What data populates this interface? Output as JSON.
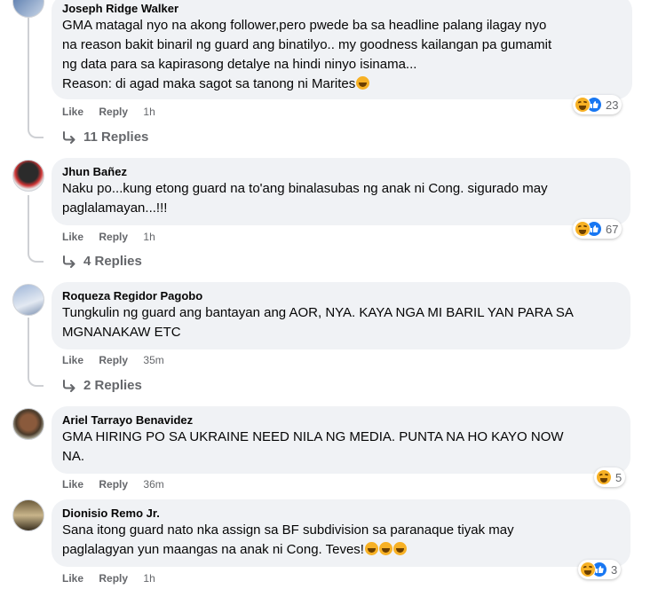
{
  "comments": [
    {
      "author": "Joseph Ridge Walker",
      "text": "GMA matagal nyo na akong follower,pero pwede ba sa headline palang ilagay nyo\nna reason bakit binaril ng guard ang binatilyo.. my goodness kailangan pa gumamit\nng data para sa kapirasong detalye na hindi ninyo isinama...\nReason: di agad maka sagot sa tanong ni Marites",
      "like": "Like",
      "reply": "Reply",
      "time": "1h",
      "reaction_count": "23",
      "replies": "11 Replies",
      "text_emoji_count": 1
    },
    {
      "author": "Jhun Bañez",
      "text": "Naku po...kung etong guard na to'ang binalasubas ng anak ni Cong. sigurado may\npaglalamayan...!!!",
      "like": "Like",
      "reply": "Reply",
      "time": "1h",
      "reaction_count": "67",
      "replies": "4 Replies"
    },
    {
      "author": "Roqueza Regidor Pagobo",
      "text": "Tungkulin ng guard ang bantayan ang AOR, NYA. KAYA NGA MI BARIL YAN PARA SA\nMGNANAKAW ETC",
      "like": "Like",
      "reply": "Reply",
      "time": "35m",
      "replies": "2 Replies"
    },
    {
      "author": "Ariel Tarrayo Benavidez",
      "text": "GMA HIRING PO SA UKRAINE NEED NILA NG MEDIA. PUNTA NA HO KAYO NOW\nNA.",
      "like": "Like",
      "reply": "Reply",
      "time": "36m",
      "reaction_count": "5"
    },
    {
      "author": "Dionisio Remo Jr.",
      "text": "Sana itong guard nato nka assign sa BF subdivision sa paranaque tiyak may\npaglalagyan yun maangas na anak ni Cong. Teves!",
      "like": "Like",
      "reply": "Reply",
      "time": "1h",
      "reaction_count": "3",
      "text_emoji_count": 3
    }
  ],
  "colors": {
    "bubble": "#f0f2f5",
    "muted": "#65676b",
    "like_blue": "#1877f2",
    "haha_yellow": "#f7b125"
  }
}
